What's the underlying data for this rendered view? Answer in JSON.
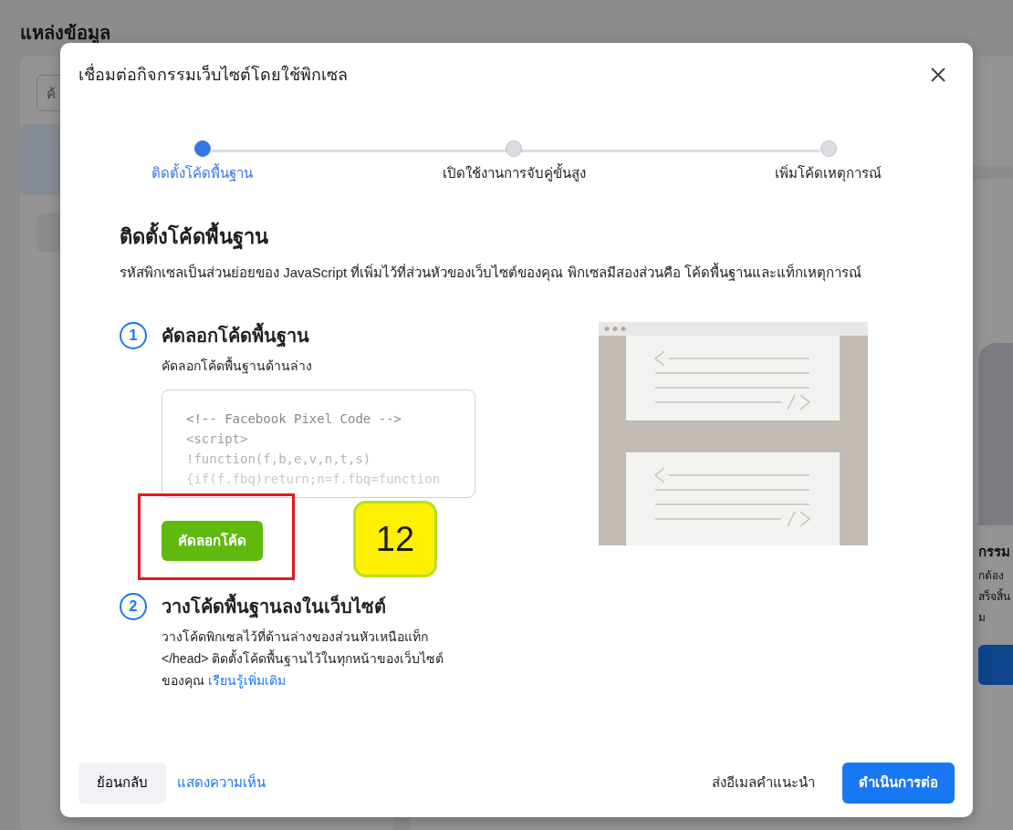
{
  "background_page": {
    "title": "แหล่งข้อมูล",
    "search": {
      "placeholder": "ค้"
    },
    "right_card": {
      "heading": "กรรม",
      "lines": [
        "กต้อง",
        "สร็จสิ้น",
        "ม"
      ]
    }
  },
  "dialog": {
    "title": "เชื่อมต่อกิจกรรมเว็บไซต์โดยใช้พิกเซล",
    "stepper": [
      {
        "label": "ติดตั้งโค้ดพื้นฐาน",
        "selected": true
      },
      {
        "label": "เปิดใช้งานการจับคู่ขั้นสูง",
        "selected": false
      },
      {
        "label": "เพิ่มโค้ดเหตุการณ์",
        "selected": false
      }
    ],
    "heading": "ติดตั้งโค้ดพื้นฐาน",
    "description": "รหัสพิกเซลเป็นส่วนย่อยของ JavaScript ที่เพิ่มไว้ที่ส่วนหัวของเว็บไซต์ของคุณ พิกเซลมีสองส่วนคือ โค้ดพื้นฐานและแท็กเหตุการณ์",
    "steps": [
      {
        "kind": "copy",
        "number": "1",
        "title": "คัดลอกโค้ดพื้นฐาน",
        "text": "คัดลอกโค้ดพื้นฐานด้านล่าง",
        "code_lines": [
          "<!-- Facebook Pixel Code -->",
          "<script>",
          "!function(f,b,e,v,n,t,s)",
          "{if(f.fbq)return;n=f.fbq=function"
        ],
        "button": "คัดลอกโค้ด",
        "annotation_badge": "12"
      },
      {
        "kind": "paste",
        "number": "2",
        "title": "วางโค้ดพื้นฐานลงในเว็บไซต์",
        "text": "วางโค้ดพิกเซลไว้ที่ด้านล่างของส่วนหัวเหนือแท็ก </head> ติดตั้งโค้ดพื้นฐานไว้ในทุกหน้าของเว็บไซต์ของคุณ",
        "link": "เรียนรู้เพิ่มเติม"
      }
    ],
    "footer": {
      "back": "ย้อนกลับ",
      "feedback": "แสดงความเห็น",
      "email": "ส่งอีเมลคำแนะนำ",
      "continue": "ดำเนินการต่อ"
    }
  }
}
